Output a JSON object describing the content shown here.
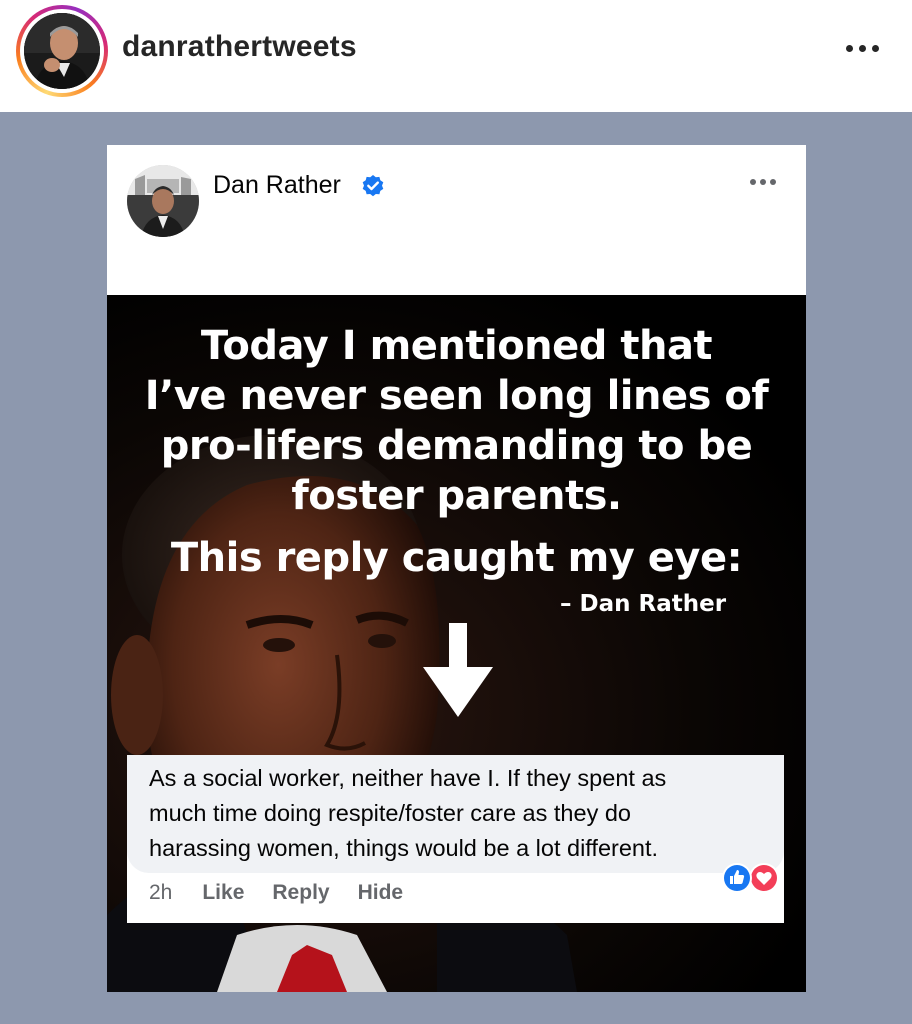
{
  "instagram": {
    "username": "danrathertweets",
    "more_icon": "more-horizontal-icon"
  },
  "colors": {
    "media_background": "#8d98ae",
    "facebook_blue": "#1877f2",
    "like_blue": "#1877f2",
    "love_red": "#f33e58"
  },
  "facebook_post": {
    "author": "Dan Rather",
    "verified_icon": "verified-badge-icon",
    "more_icon": "more-horizontal-icon",
    "meme": {
      "quote_lines": [
        "Today I mentioned that",
        "I’ve never seen long lines of",
        "pro-lifers demanding to be",
        "foster parents."
      ],
      "reply_line": "This reply caught my eye:",
      "attribution": "– Dan Rather",
      "arrow_icon": "down-arrow-icon"
    },
    "comment": {
      "lines": [
        "As a social worker, neither have I. If they spent as",
        "much time doing respite/foster care as they do",
        "harassing women, things would be a lot different."
      ],
      "time": "2h",
      "like_label": "Like",
      "reply_label": "Reply",
      "hide_label": "Hide",
      "reactions": [
        "like-reaction-icon",
        "love-reaction-icon"
      ]
    }
  }
}
